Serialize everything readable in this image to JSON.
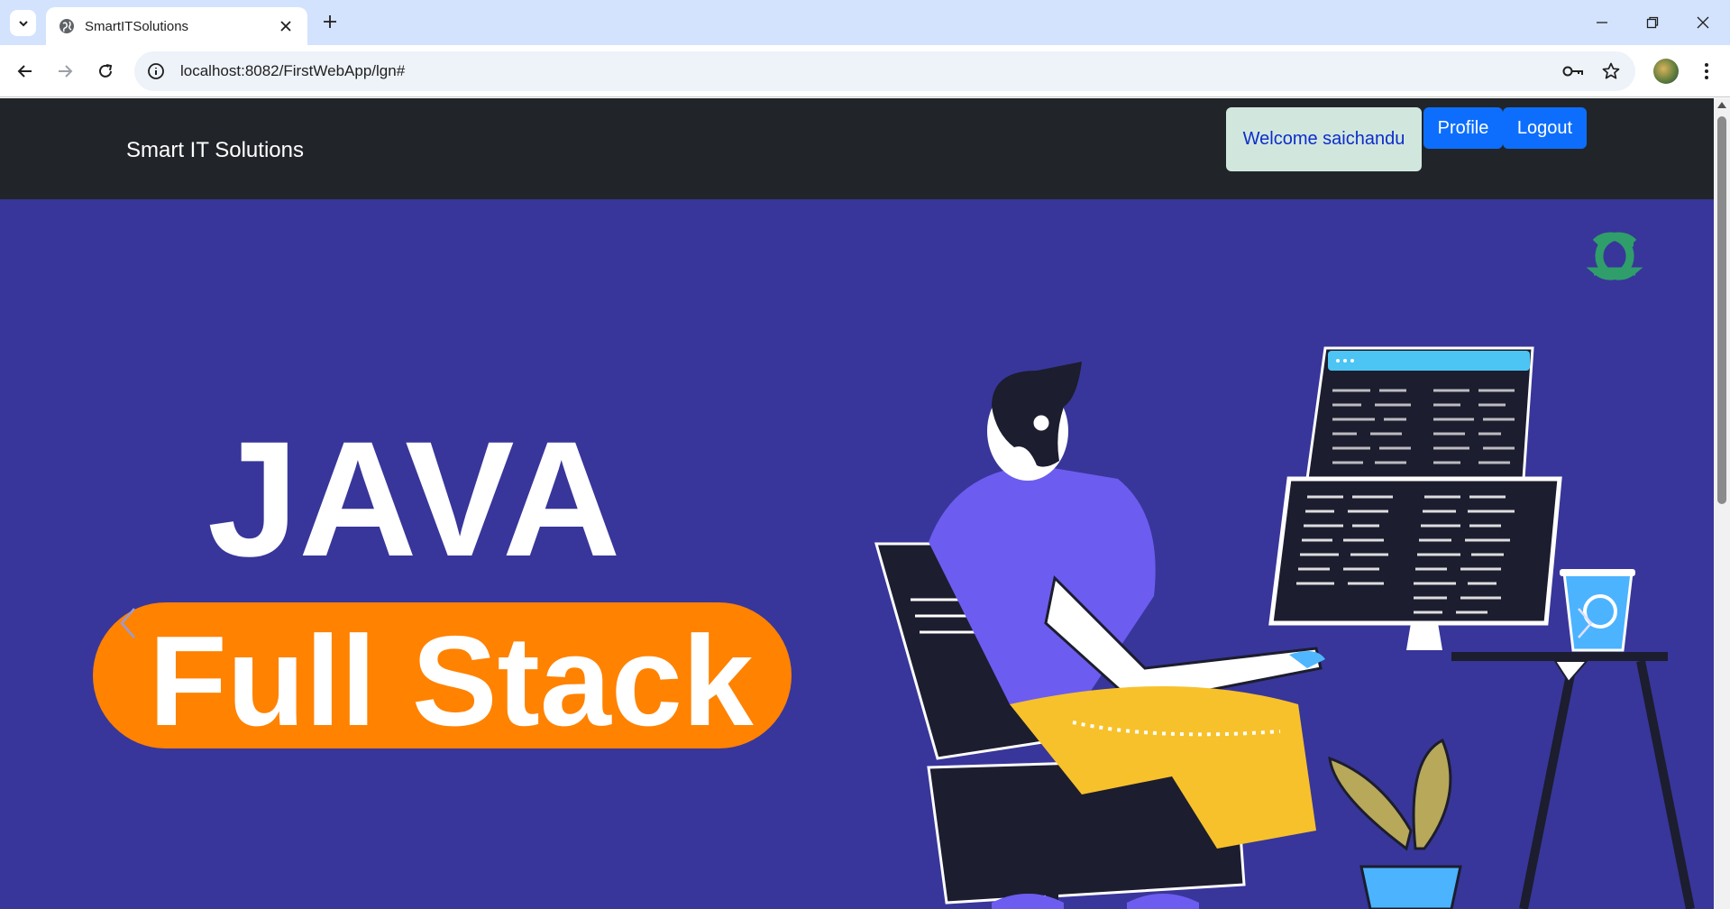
{
  "browser": {
    "tab_title": "SmartITSolutions",
    "url": "localhost:8082/FirstWebApp/lgn#"
  },
  "navbar": {
    "brand": "Smart IT Solutions",
    "welcome": "Welcome saichandu",
    "profile_label": "Profile",
    "logout_label": "Logout"
  },
  "carousel": {
    "headline": "JAVA",
    "pill_text": "Full Stack",
    "logo_text": "GfG"
  },
  "colors": {
    "navbar_bg": "#212529",
    "carousel_bg": "#38369a",
    "button_blue": "#0d6efd",
    "welcome_bg": "#d1e7dd",
    "pill_orange": "#ff8200",
    "logo_green": "#2f9e6a"
  },
  "icons": [
    "tab-search-icon",
    "globe-icon",
    "close-icon",
    "plus-icon",
    "minimize-icon",
    "restore-icon",
    "window-close-icon",
    "back-arrow-icon",
    "forward-arrow-icon",
    "reload-icon",
    "site-info-icon",
    "key-icon",
    "star-icon",
    "more-vert-icon",
    "chevron-left-icon",
    "chevron-right-icon"
  ]
}
